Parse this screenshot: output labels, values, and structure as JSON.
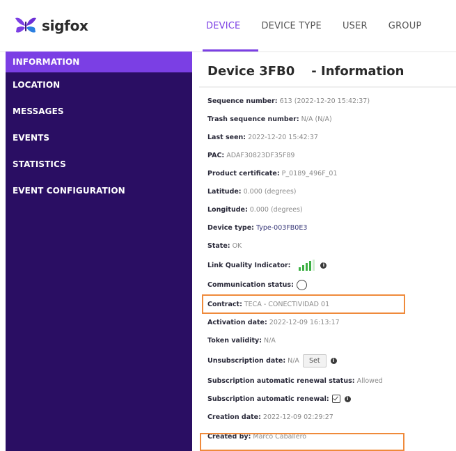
{
  "brand": {
    "name": "sigfox"
  },
  "nav": {
    "items": [
      "DEVICE",
      "DEVICE TYPE",
      "USER",
      "GROUP"
    ],
    "active": "DEVICE"
  },
  "sidebar": {
    "items": [
      {
        "label": "INFORMATION",
        "active": true
      },
      {
        "label": "LOCATION"
      },
      {
        "label": "MESSAGES"
      },
      {
        "label": "EVENTS"
      },
      {
        "label": "STATISTICS"
      },
      {
        "label": "EVENT CONFIGURATION"
      }
    ]
  },
  "page": {
    "device": "Device 3FB0",
    "section": "- Information"
  },
  "fields": {
    "sequence_number": {
      "label": "Sequence number:",
      "value": "613 (2022-12-20 15:42:37)"
    },
    "trash_sequence_number": {
      "label": "Trash sequence number:",
      "value": "N/A (N/A)"
    },
    "last_seen": {
      "label": "Last seen:",
      "value": "2022-12-20 15:42:37"
    },
    "pac": {
      "label": "PAC:",
      "value": "ADAF30823DF35F89"
    },
    "product_certificate": {
      "label": "Product certificate:",
      "value": "P_0189_496F_01"
    },
    "latitude": {
      "label": "Latitude:",
      "value": "0.000 (degrees)"
    },
    "longitude": {
      "label": "Longitude:",
      "value": "0.000 (degrees)"
    },
    "device_type": {
      "label": "Device type:",
      "value": "Type-003FB0E3"
    },
    "state": {
      "label": "State:",
      "value": "OK"
    },
    "link_quality": {
      "label": "Link Quality Indicator:",
      "bars": 4,
      "max_bars": 4,
      "color": "#3cb043"
    },
    "communication_status": {
      "label": "Communication status:"
    },
    "contract": {
      "label": "Contract:",
      "value": "TECA - CONECTIVIDAD 01"
    },
    "activation_date": {
      "label": "Activation date:",
      "value": "2022-12-09 16:13:17"
    },
    "token_validity": {
      "label": "Token validity:",
      "value": "N/A"
    },
    "unsubscription_date": {
      "label": "Unsubscription date:",
      "value": "N/A",
      "button": "Set"
    },
    "sub_auto_renewal_status": {
      "label": "Subscription automatic renewal status:",
      "value": "Allowed"
    },
    "sub_auto_renewal": {
      "label": "Subscription automatic renewal:",
      "checked": true
    },
    "creation_date": {
      "label": "Creation date:",
      "value": "2022-12-09 02:29:27"
    },
    "created_by": {
      "label": "Created by:",
      "value": "Marco Caballero"
    }
  },
  "colors": {
    "accent": "#7b3fe4",
    "sidebar": "#2a0e63",
    "highlight": "#ef8a3b",
    "signal": "#3cb043"
  },
  "icons": {
    "info": "info-icon",
    "logo": "sigfox-butterfly-logo",
    "status": "status-circle-icon",
    "checkbox": "checkbox-checked-icon"
  }
}
